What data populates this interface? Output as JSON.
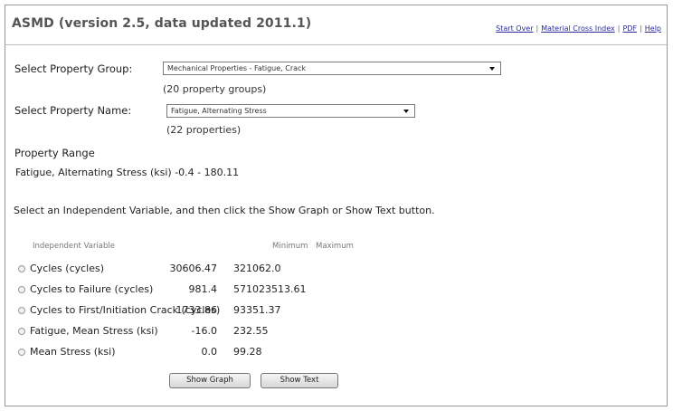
{
  "header": {
    "title": "ASMD (version 2.5, data updated 2011.1)",
    "links": [
      "Start Over",
      "Material Cross Index",
      "PDF",
      "Help"
    ],
    "separator": "|"
  },
  "form": {
    "group_label": "Select Property Group:",
    "group_value": "Mechanical Properties - Fatigue, Crack",
    "group_count": "(20 property groups)",
    "name_label": "Select Property Name:",
    "name_value": "Fatigue, Alternating Stress",
    "name_count": "(22 properties)"
  },
  "range": {
    "heading": "Property Range",
    "text": "Fatigue, Alternating Stress (ksi) -0.4 - 180.11"
  },
  "instruction": "Select an Independent Variable, and then click the Show Graph or Show Text button.",
  "table": {
    "headers": [
      "Independent Variable",
      "Minimum",
      "Maximum"
    ],
    "rows": [
      {
        "name": "Cycles (cycles)",
        "min": "30606.47",
        "max": "321062.0"
      },
      {
        "name": "Cycles to Failure (cycles)",
        "min": "981.4",
        "max": "571023513.61"
      },
      {
        "name": "Cycles to First/Initiation Crack (cycles)",
        "min": "1733.86",
        "max": "93351.37"
      },
      {
        "name": "Fatigue, Mean Stress (ksi)",
        "min": "-16.0",
        "max": "232.55"
      },
      {
        "name": "Mean Stress (ksi)",
        "min": "0.0",
        "max": "99.28"
      }
    ]
  },
  "buttons": {
    "show_graph": "Show Graph",
    "show_text": "Show Text"
  }
}
